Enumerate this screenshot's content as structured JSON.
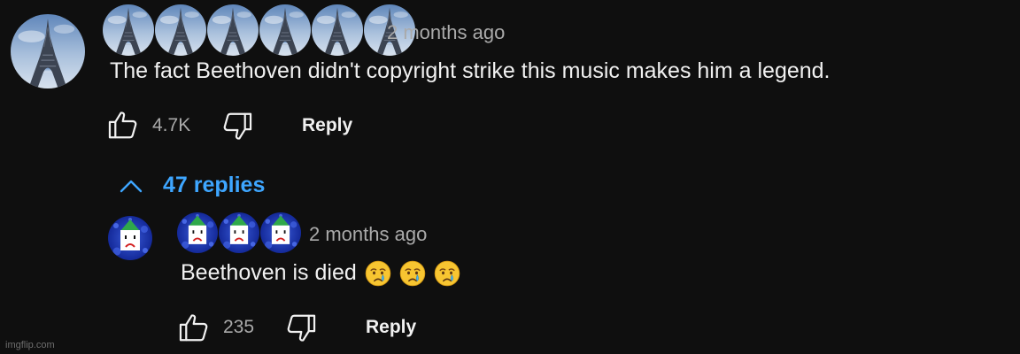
{
  "comment": {
    "author_icon": "eiffel-tower-avatar",
    "timestamp": "2 months ago",
    "text": "The fact Beethoven didn't copyright strike this music makes him a legend.",
    "like_count": "4.7K",
    "reply_label": "Reply"
  },
  "replies_toggle": {
    "label": "47 replies",
    "icon": "chevron-up-icon"
  },
  "reply": {
    "author_icon": "sad-green-hat-avatar",
    "timestamp": "2 months ago",
    "text": "Beethoven is died",
    "emojis": [
      "crying-face",
      "crying-face",
      "crying-face"
    ],
    "like_count": "235",
    "reply_label": "Reply"
  },
  "watermark": "imgflip.com",
  "colors": {
    "background": "#0f0f0f",
    "text": "#f1f1f1",
    "secondary_text": "#aaaaaa",
    "link_blue": "#3ea6ff"
  }
}
